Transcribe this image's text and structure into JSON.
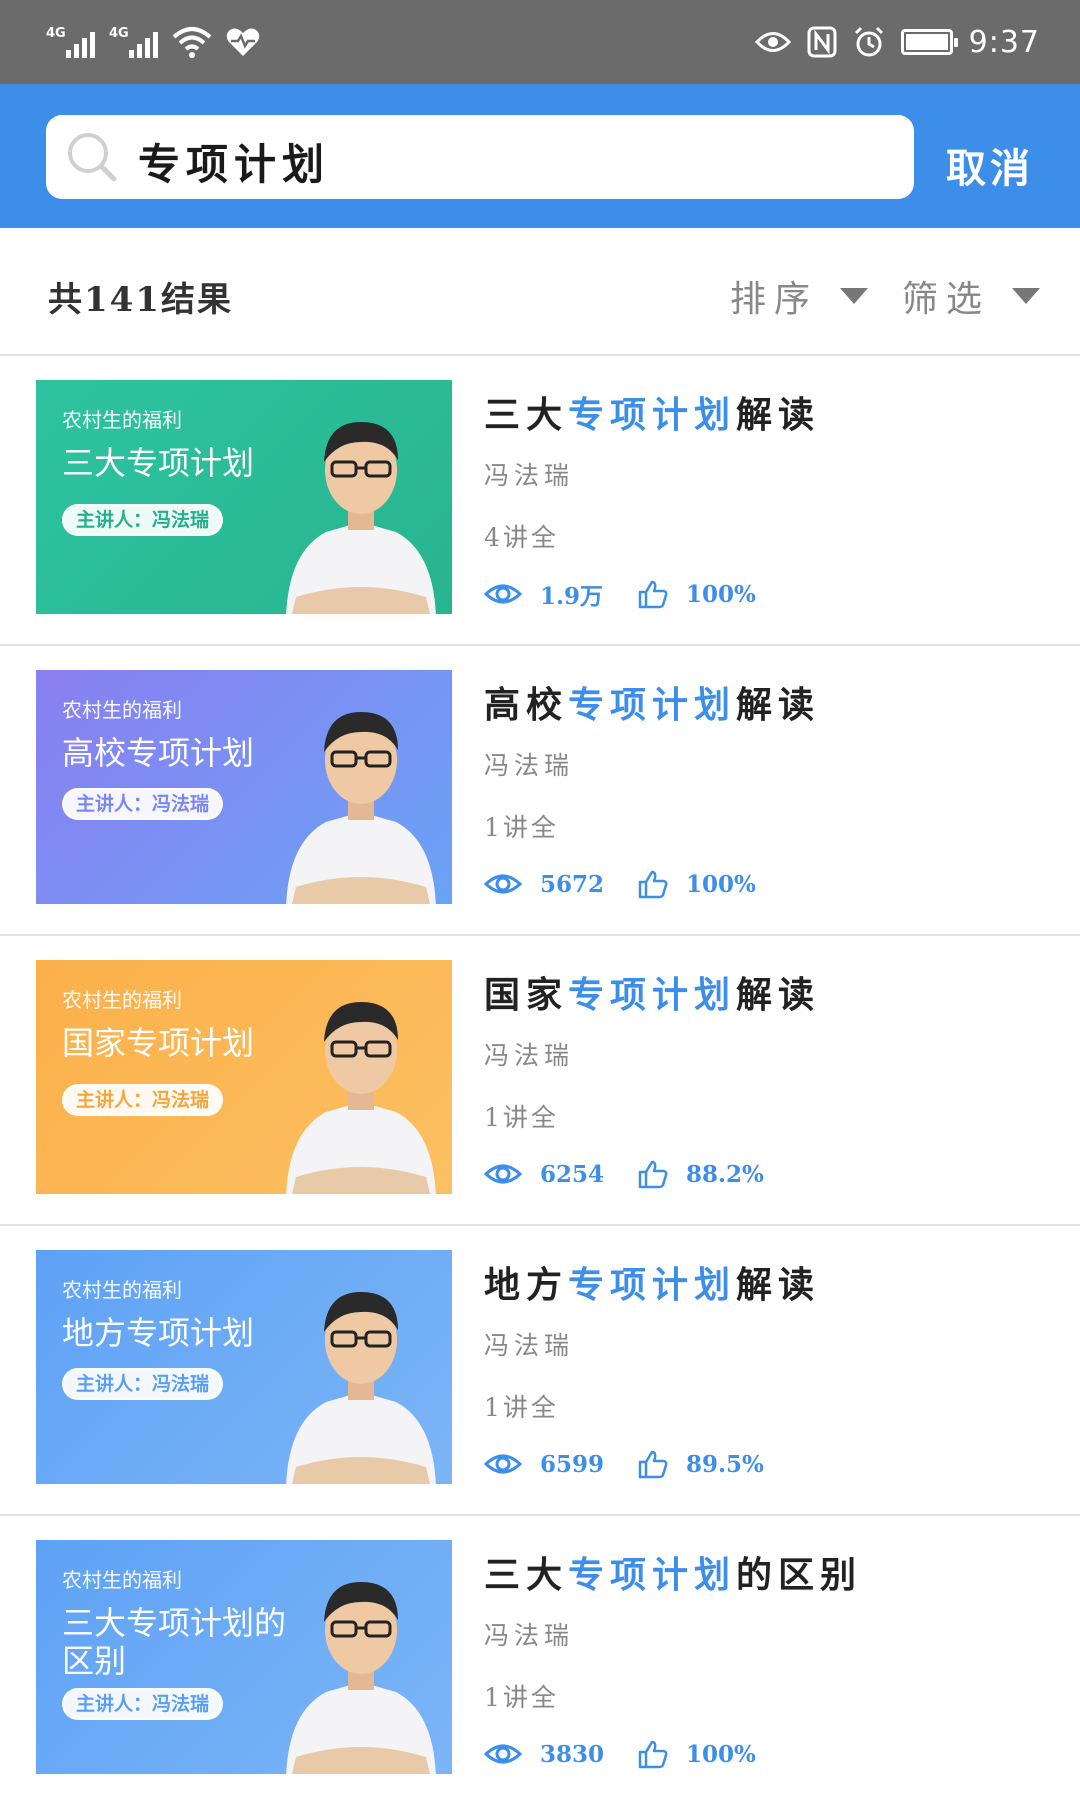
{
  "status_bar": {
    "network_1": "4G",
    "network_2": "4G",
    "time": "9:37",
    "icons": [
      "signal-icon",
      "signal-icon",
      "wifi-icon",
      "heart-pulse-icon",
      "eye-icon",
      "nfc-icon",
      "alarm-icon",
      "battery-icon"
    ],
    "battery_level": 1.0
  },
  "search": {
    "query": "专项计划",
    "cancel_label": "取消"
  },
  "filter_bar": {
    "result_count": "共141结果",
    "sort_label": "排序",
    "filter_label": "筛选"
  },
  "colors": {
    "accent": "#3d8ee8",
    "status_bar": "#6b6b6b"
  },
  "items": [
    {
      "title_pre": "三大",
      "title_hl": "专项计划",
      "title_post": "解读",
      "author": "冯法瑞",
      "lectures": "4讲全",
      "views": "1.9万",
      "likes": "100%",
      "thumb": {
        "tagline": "农村生的福利",
        "title": "三大专项计划",
        "presenter": "主讲人：冯法瑞",
        "bg_from": "#2ec3a0",
        "bg_to": "#27b58f"
      }
    },
    {
      "title_pre": "高校",
      "title_hl": "专项计划",
      "title_post": "解读",
      "author": "冯法瑞",
      "lectures": "1讲全",
      "views": "5672",
      "likes": "100%",
      "thumb": {
        "tagline": "农村生的福利",
        "title": "高校专项计划",
        "presenter": "主讲人：冯法瑞",
        "bg_from": "#8a7ff2",
        "bg_to": "#6aa3f5"
      }
    },
    {
      "title_pre": "国家",
      "title_hl": "专项计划",
      "title_post": "解读",
      "author": "冯法瑞",
      "lectures": "1讲全",
      "views": "6254",
      "likes": "88.2%",
      "thumb": {
        "tagline": "农村生的福利",
        "title": "国家专项计划",
        "presenter": "主讲人：冯法瑞",
        "bg_from": "#fbb04a",
        "bg_to": "#fcc062"
      }
    },
    {
      "title_pre": "地方",
      "title_hl": "专项计划",
      "title_post": "解读",
      "author": "冯法瑞",
      "lectures": "1讲全",
      "views": "6599",
      "likes": "89.5%",
      "thumb": {
        "tagline": "农村生的福利",
        "title": "地方专项计划",
        "presenter": "主讲人：冯法瑞",
        "bg_from": "#5ea2f5",
        "bg_to": "#7cb5f7"
      }
    },
    {
      "title_pre": "三大",
      "title_hl": "专项计划",
      "title_post": "的区别",
      "author": "冯法瑞",
      "lectures": "1讲全",
      "views": "3830",
      "likes": "100%",
      "thumb": {
        "tagline": "农村生的福利",
        "title": "三大专项计划的区别",
        "presenter": "主讲人：冯法瑞",
        "bg_from": "#5ea2f5",
        "bg_to": "#7cb5f7"
      }
    }
  ]
}
